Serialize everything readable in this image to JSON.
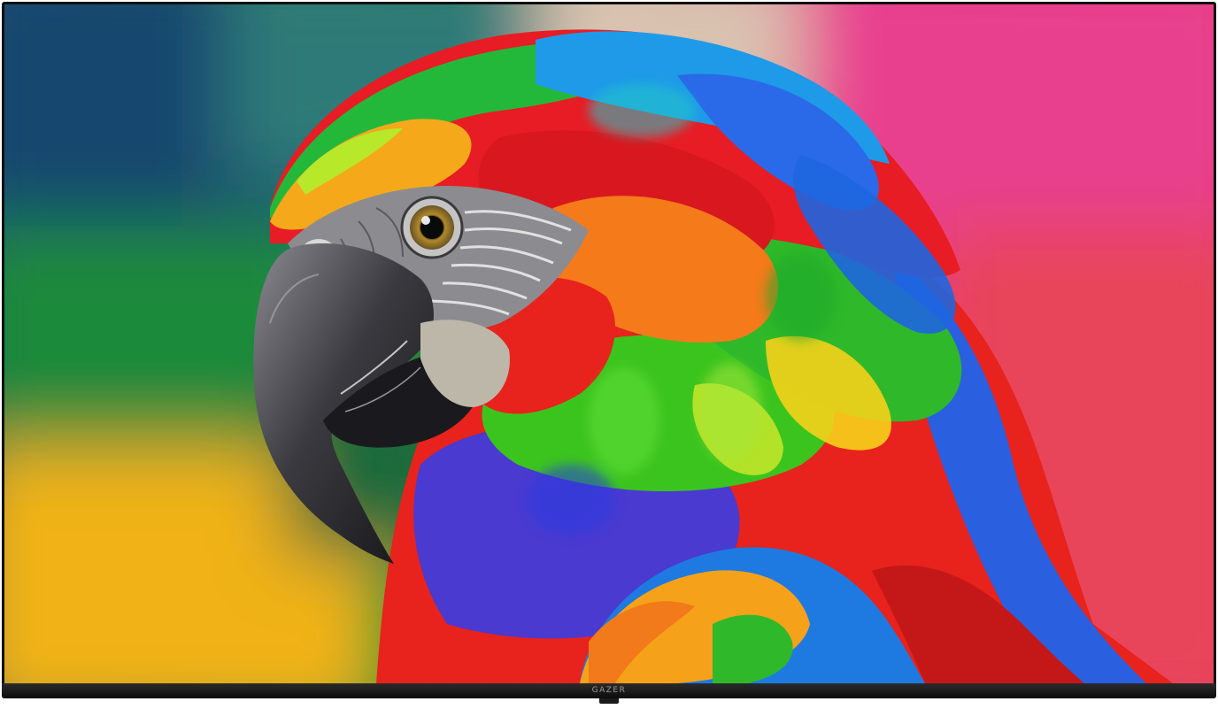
{
  "tv": {
    "brand": "GAZER"
  },
  "screen": {
    "subject": "parrot-artwork",
    "colors": {
      "background_left": "#1a4d78",
      "background_right": "#e34060",
      "plumage_red": "#e8221c",
      "plumage_green": "#34c21e",
      "plumage_blue": "#2a5fe0",
      "plumage_yellow": "#f5c21a",
      "beak": "#2a2a2e"
    }
  }
}
